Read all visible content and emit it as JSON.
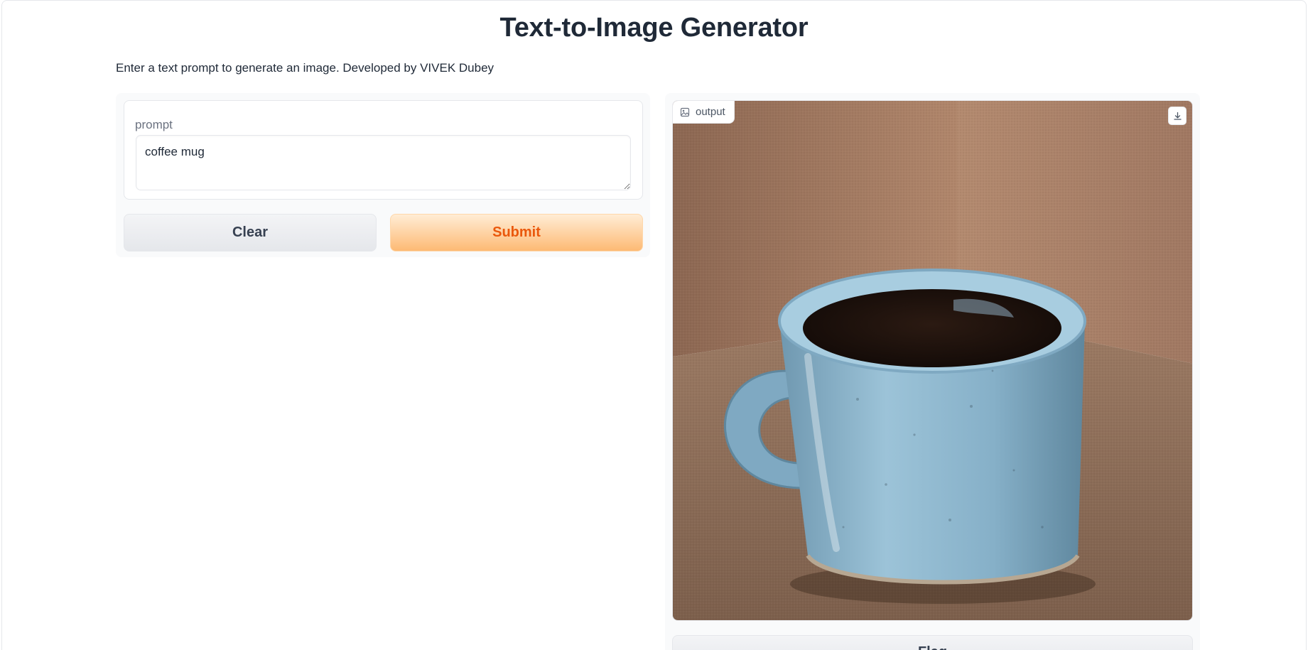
{
  "header": {
    "title": "Text-to-Image Generator",
    "description": "Enter a text prompt to generate an image. Developed by VIVEK Dubey"
  },
  "input_panel": {
    "prompt_label": "prompt",
    "prompt_value": "coffee mug",
    "clear_label": "Clear",
    "submit_label": "Submit"
  },
  "output_panel": {
    "output_label": "output",
    "image_icon": "image-icon",
    "download_icon": "download-icon",
    "flag_label": "Flag"
  },
  "colors": {
    "submit_text": "#ea580c",
    "submit_bg": "#fdba74",
    "mug": "#8fb6cf",
    "background_fabric": "#a67d63"
  }
}
